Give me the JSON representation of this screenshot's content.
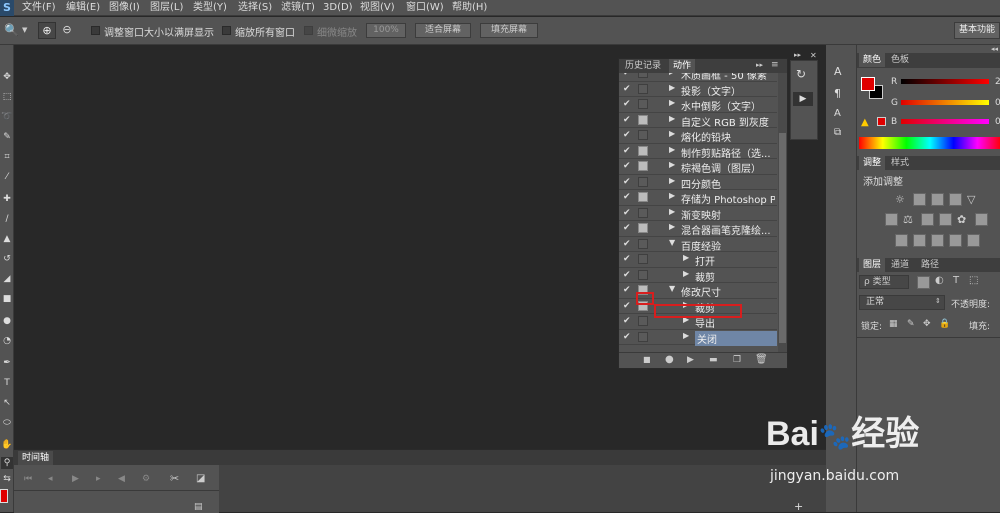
{
  "app": {
    "logo": "S"
  },
  "menu": [
    "文件(F)",
    "编辑(E)",
    "图像(I)",
    "图层(L)",
    "类型(Y)",
    "选择(S)",
    "滤镜(T)",
    "3D(D)",
    "视图(V)",
    "窗口(W)",
    "帮助(H)"
  ],
  "options": {
    "fit_window_label": "调整窗口大小以满屏显示",
    "zoom_all_label": "缩放所有窗口",
    "scrubby_label": "细微缩放",
    "zoom_pct": "100%",
    "fit_screen": "适合屏幕",
    "fill_screen": "填充屏幕",
    "workspace": "基本功能"
  },
  "actions_panel": {
    "tabs": [
      "历史记录",
      "动作"
    ],
    "rows": [
      {
        "check": "✔",
        "filled": false,
        "indent": 1,
        "arrow": "▶",
        "label": "木质画框 - 50 像素"
      },
      {
        "check": "✔",
        "filled": false,
        "indent": 1,
        "arrow": "▶",
        "label": "投影（文字）"
      },
      {
        "check": "✔",
        "filled": false,
        "indent": 1,
        "arrow": "▶",
        "label": "水中倒影（文字）"
      },
      {
        "check": "✔",
        "filled": true,
        "indent": 1,
        "arrow": "▶",
        "label": "自定义 RGB 到灰度"
      },
      {
        "check": "✔",
        "filled": false,
        "indent": 1,
        "arrow": "▶",
        "label": "熔化的铅块"
      },
      {
        "check": "✔",
        "filled": true,
        "indent": 1,
        "arrow": "▶",
        "label": "制作剪贴路径（选..."
      },
      {
        "check": "✔",
        "filled": true,
        "indent": 1,
        "arrow": "▶",
        "label": "棕褐色调（图层）"
      },
      {
        "check": "✔",
        "filled": false,
        "indent": 1,
        "arrow": "▶",
        "label": "四分颜色"
      },
      {
        "check": "✔",
        "filled": true,
        "indent": 1,
        "arrow": "▶",
        "label": "存储为 Photoshop P..."
      },
      {
        "check": "✔",
        "filled": false,
        "indent": 1,
        "arrow": "▶",
        "label": "渐变映射"
      },
      {
        "check": "✔",
        "filled": true,
        "indent": 1,
        "arrow": "▶",
        "label": "混合器画笔克隆绘..."
      },
      {
        "check": "✔",
        "filled": false,
        "indent": 0,
        "arrow": "▼",
        "label": "百度经验"
      },
      {
        "check": "✔",
        "filled": false,
        "indent": 2,
        "arrow": "▶",
        "label": "打开"
      },
      {
        "check": "✔",
        "filled": false,
        "indent": 2,
        "arrow": "▶",
        "label": "裁剪"
      },
      {
        "check": "✔",
        "filled": true,
        "indent": 0,
        "arrow": "▼",
        "label": "修改尺寸"
      },
      {
        "check": "✔",
        "filled": true,
        "indent": 2,
        "arrow": "▶",
        "label": "裁剪"
      },
      {
        "check": "✔",
        "filled": false,
        "indent": 2,
        "arrow": "▶",
        "label": "导出"
      },
      {
        "check": "✔",
        "filled": false,
        "indent": 2,
        "arrow": "▶",
        "label": "关闭"
      }
    ],
    "highlighted_row": 17,
    "bottom_icons": [
      "stop-icon",
      "record-icon",
      "play-icon",
      "folder-icon",
      "new-action-icon",
      "delete-icon"
    ]
  },
  "color_panel": {
    "tabs": [
      "颜色",
      "色板"
    ],
    "channels": [
      {
        "name": "R",
        "value": "2"
      },
      {
        "name": "G",
        "value": "0"
      },
      {
        "name": "B",
        "value": "0"
      }
    ],
    "fg_color": "#e00000",
    "bg_color": "#000000"
  },
  "adjust_panel": {
    "tabs": [
      "调整",
      "样式"
    ],
    "title": "添加调整"
  },
  "layers_panel": {
    "tabs": [
      "图层",
      "通道",
      "路径"
    ],
    "kind_label": "ρ 类型",
    "blend_mode": "正常",
    "opacity_label": "不透明度:",
    "lock_label": "锁定:",
    "fill_label": "填充:"
  },
  "timeline": {
    "tab": "时间轴"
  },
  "watermark": {
    "brand": "Bai",
    "brand2": "经验",
    "url": "jingyan.baidu.com"
  }
}
